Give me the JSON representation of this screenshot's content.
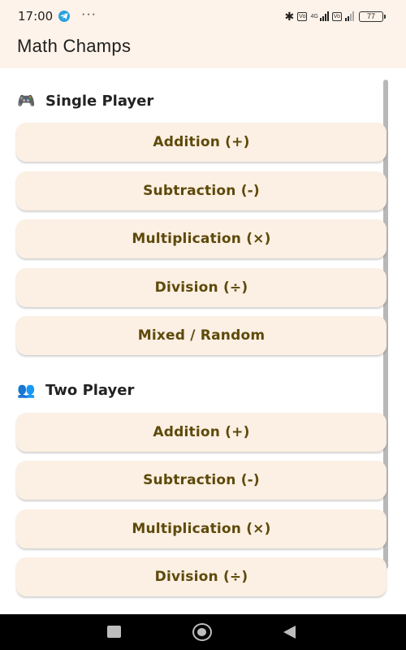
{
  "status_bar": {
    "time": "17:00",
    "more": "···",
    "network_label_1": "4G",
    "battery": "77"
  },
  "app": {
    "title": "Math Champs"
  },
  "sections": {
    "single": {
      "icon": "🎮",
      "title": "Single Player",
      "buttons": [
        "Addition (+)",
        "Subtraction (-)",
        "Multiplication (×)",
        "Division (÷)",
        "Mixed / Random"
      ]
    },
    "two": {
      "icon": "👥",
      "title": "Two Player",
      "buttons": [
        "Addition (+)",
        "Subtraction (-)",
        "Multiplication (×)",
        "Division (÷)"
      ]
    }
  },
  "colors": {
    "button_bg": "#fcefe3",
    "button_text": "#5d4a0a",
    "app_bar_bg": "#fdf3ea"
  },
  "icons": {
    "single_player": "gamepad-icon",
    "two_player": "users-icon",
    "telegram": "telegram-icon",
    "bluetooth": "bluetooth-icon"
  }
}
